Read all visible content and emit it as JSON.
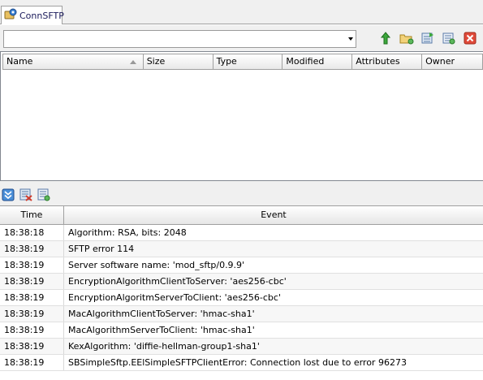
{
  "tab": {
    "label": "ConnSFTP"
  },
  "toolbar": {
    "path_value": "",
    "buttons": [
      {
        "icon": "up-arrow-icon"
      },
      {
        "icon": "new-folder-icon"
      },
      {
        "icon": "refresh-icon"
      },
      {
        "icon": "properties-icon"
      },
      {
        "icon": "delete-icon"
      }
    ]
  },
  "file_list": {
    "columns": [
      "Name",
      "Size",
      "Type",
      "Modified",
      "Attributes",
      "Owner"
    ]
  },
  "log_toolbar": {
    "buttons": [
      {
        "icon": "collapse-icon"
      },
      {
        "icon": "clear-log-icon"
      },
      {
        "icon": "save-log-icon"
      }
    ]
  },
  "log": {
    "headers": {
      "time": "Time",
      "event": "Event"
    },
    "rows": [
      {
        "time": "18:38:18",
        "event": "Algorithm: RSA, bits: 2048"
      },
      {
        "time": "18:38:19",
        "event": "SFTP error 114"
      },
      {
        "time": "18:38:19",
        "event": "Server software name: 'mod_sftp/0.9.9'"
      },
      {
        "time": "18:38:19",
        "event": "EncryptionAlgorithmClientToServer: 'aes256-cbc'"
      },
      {
        "time": "18:38:19",
        "event": "EncryptionAlgoritmServerToClient: 'aes256-cbc'"
      },
      {
        "time": "18:38:19",
        "event": "MacAlgorithmClientToServer: 'hmac-sha1'"
      },
      {
        "time": "18:38:19",
        "event": "MacAlgorithmServerToClient: 'hmac-sha1'"
      },
      {
        "time": "18:38:19",
        "event": "KexAlgorithm: 'diffie-hellman-group1-sha1'"
      },
      {
        "time": "18:38:19",
        "event": "SBSimpleSftp.EElSimpleSFTPClientError: Connection lost due to error 96273"
      }
    ]
  }
}
